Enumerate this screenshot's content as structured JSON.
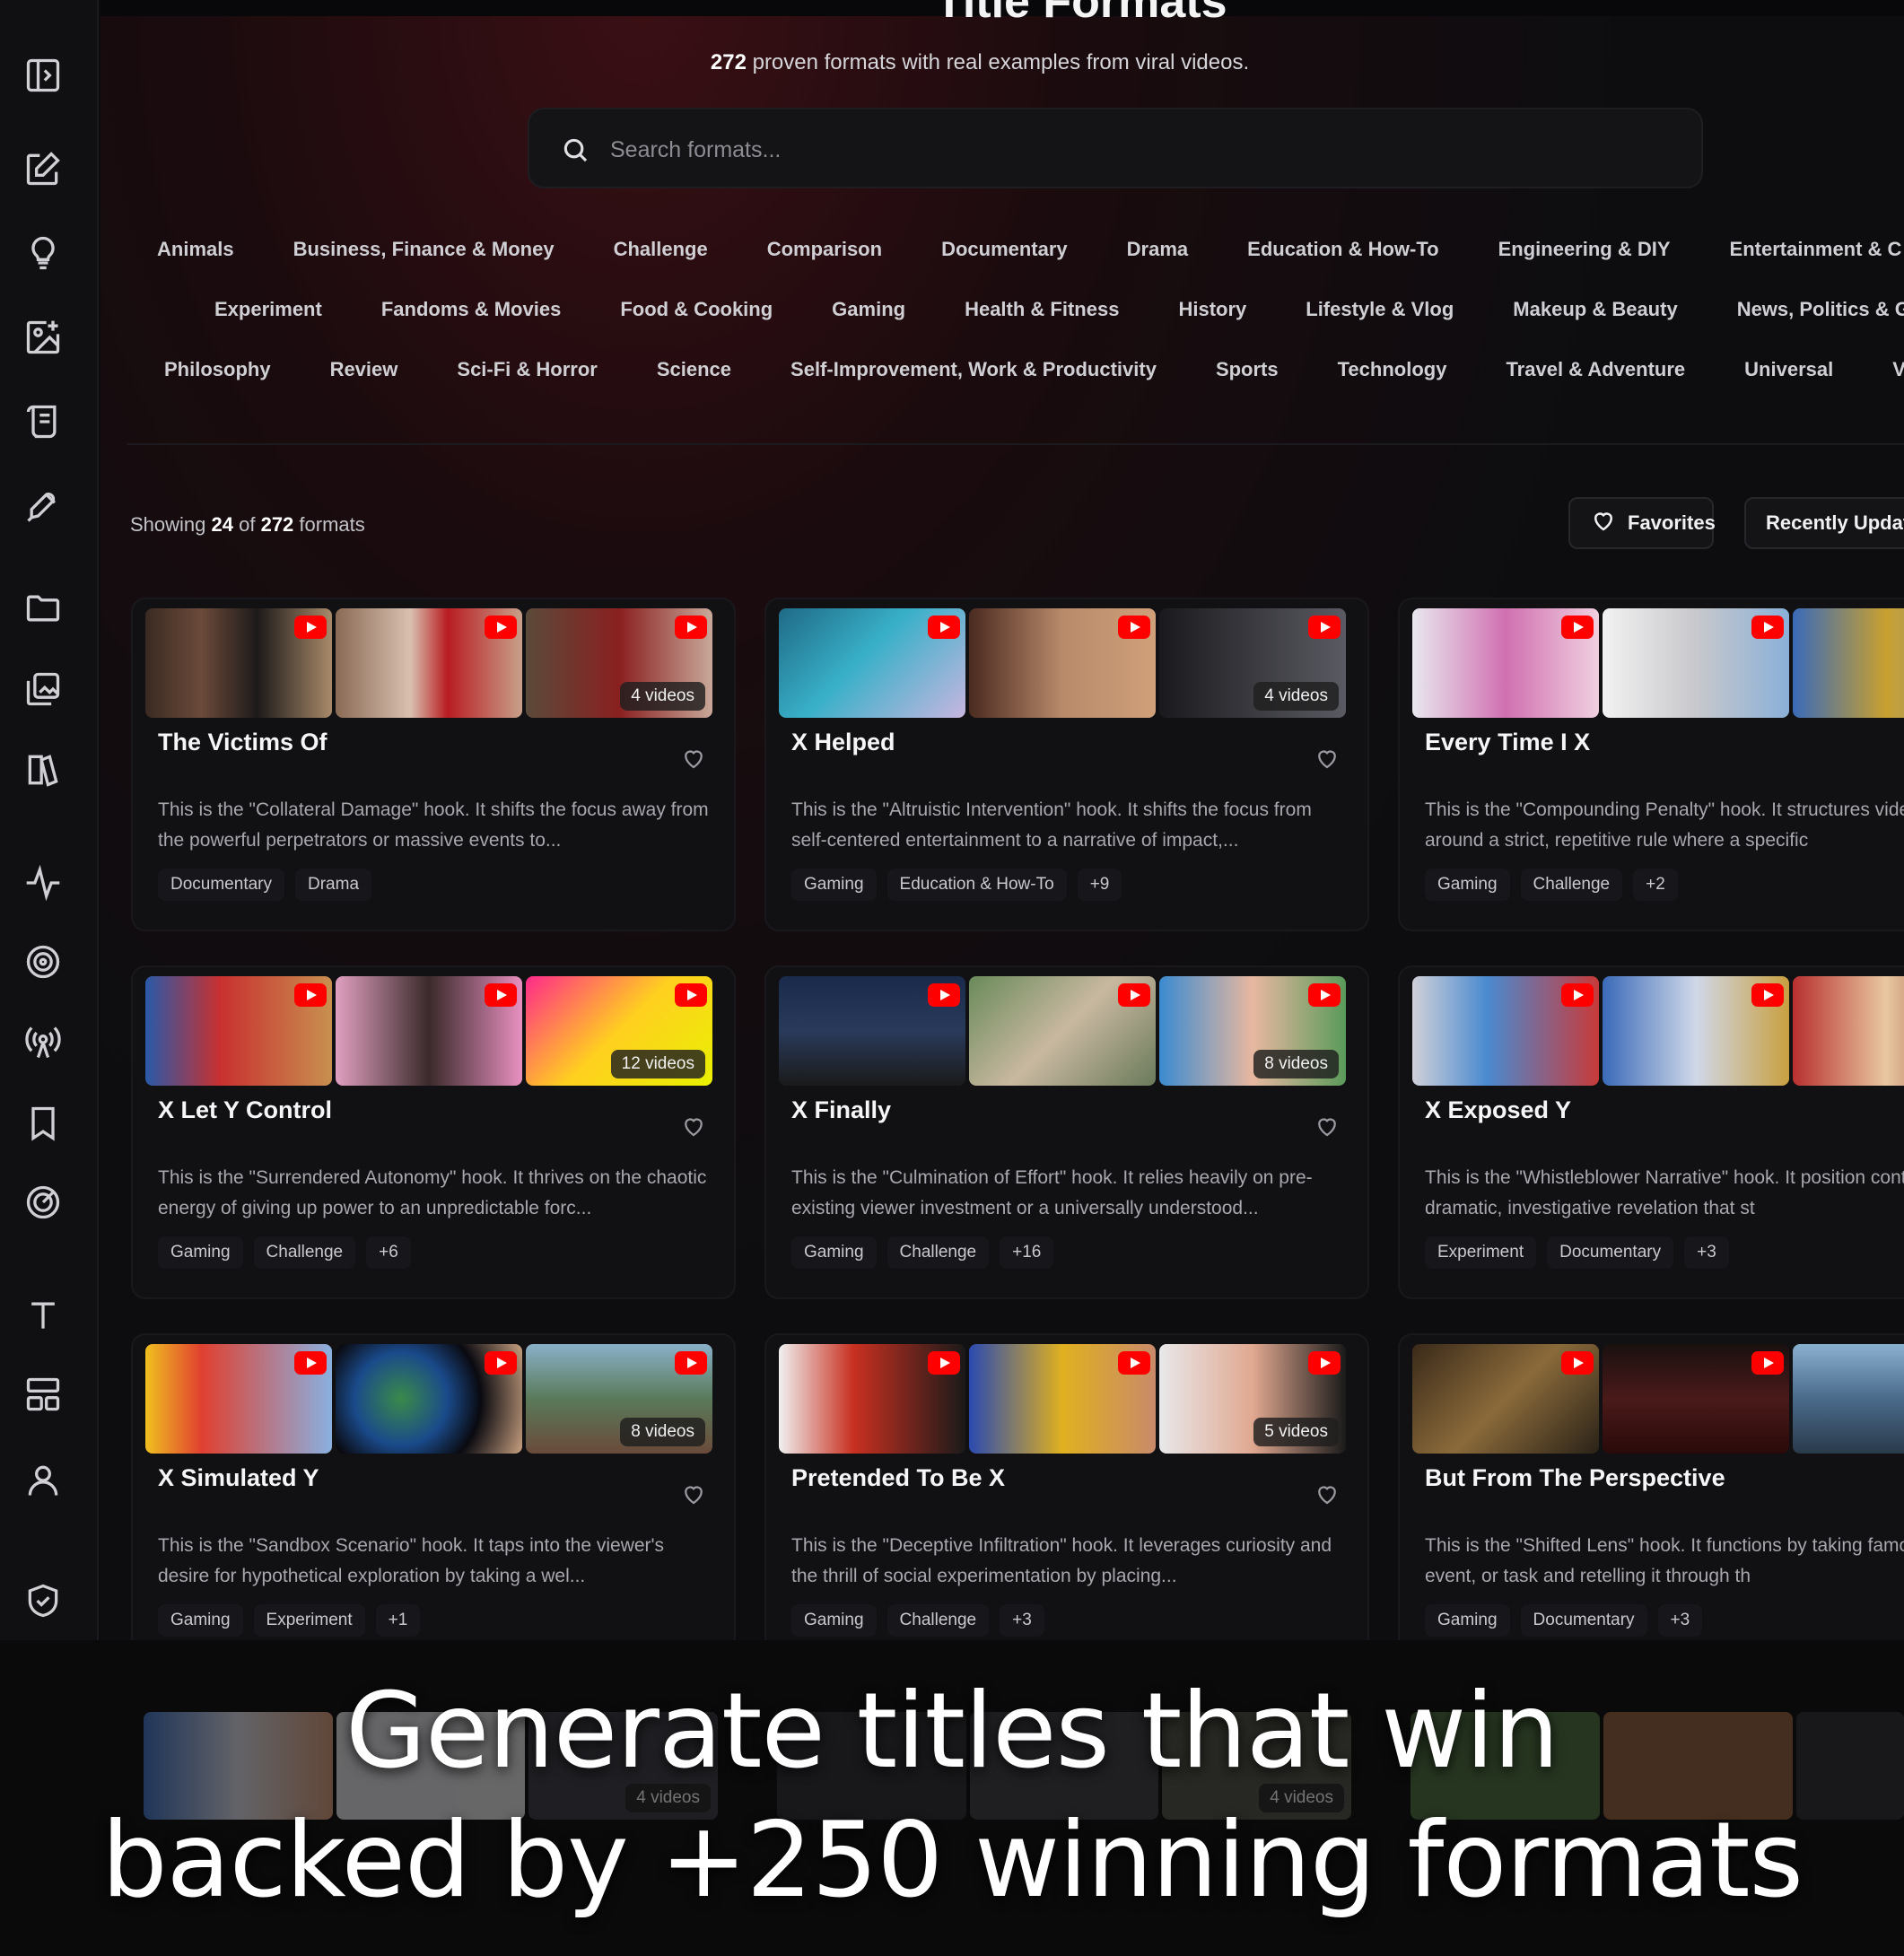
{
  "header": {
    "title_partial": "Title Formats",
    "subtitle_count": "272",
    "subtitle_rest": " proven formats with real examples from viral videos."
  },
  "search": {
    "placeholder": "Search formats..."
  },
  "categories": {
    "row1": [
      "Animals",
      "Business, Finance & Money",
      "Challenge",
      "Comparison",
      "Documentary",
      "Drama",
      "Education & How-To",
      "Engineering & DIY",
      "Entertainment & C"
    ],
    "row2": [
      "Experiment",
      "Fandoms & Movies",
      "Food & Cooking",
      "Gaming",
      "Health & Fitness",
      "History",
      "Lifestyle & Vlog",
      "Makeup & Beauty",
      "News, Politics & Geo"
    ],
    "row3": [
      "Philosophy",
      "Review",
      "Sci-Fi & Horror",
      "Science",
      "Self-Improvement, Work & Productivity",
      "Sports",
      "Technology",
      "Travel & Adventure",
      "Universal",
      "Ve"
    ]
  },
  "results": {
    "prefix": "Showing ",
    "shown": "24",
    "of": " of ",
    "total": "272",
    "suffix": " formats"
  },
  "toolbar": {
    "favorites_label": "Favorites",
    "sort_label": "Recently Updat"
  },
  "cards": [
    {
      "title": "The Victims Of",
      "videos": "4 videos",
      "desc": "This is the \"Collateral Damage\" hook. It shifts the focus away from the powerful perpetrators or massive events to...",
      "tags": [
        "Documentary",
        "Drama"
      ],
      "extra": ""
    },
    {
      "title": "X Helped",
      "videos": "4 videos",
      "desc": "This is the \"Altruistic Intervention\" hook. It shifts the focus from self-centered entertainment to a narrative of impact,...",
      "tags": [
        "Gaming",
        "Education & How-To"
      ],
      "extra": "+9"
    },
    {
      "title": "Every Time I X",
      "videos": "",
      "desc": "This is the \"Compounding Penalty\" hook. It structures video around a strict, repetitive rule where a specific",
      "tags": [
        "Gaming",
        "Challenge"
      ],
      "extra": "+2"
    },
    {
      "title": "X Let Y Control",
      "videos": "12 videos",
      "desc": "This is the \"Surrendered Autonomy\" hook. It thrives on the chaotic energy of giving up power to an unpredictable forc...",
      "tags": [
        "Gaming",
        "Challenge"
      ],
      "extra": "+6"
    },
    {
      "title": "X Finally",
      "videos": "8 videos",
      "desc": "This is the \"Culmination of Effort\" hook. It relies heavily on pre-existing viewer investment or a universally understood...",
      "tags": [
        "Gaming",
        "Challenge"
      ],
      "extra": "+16"
    },
    {
      "title": "X Exposed Y",
      "videos": "",
      "desc": "This is the \"Whistleblower Narrative\" hook. It position content as a dramatic, investigative revelation that st",
      "tags": [
        "Experiment",
        "Documentary"
      ],
      "extra": "+3"
    },
    {
      "title": "X Simulated Y",
      "videos": "8 videos",
      "desc": "This is the \"Sandbox Scenario\" hook. It taps into the viewer's desire for hypothetical exploration by taking a wel...",
      "tags": [
        "Gaming",
        "Experiment"
      ],
      "extra": "+1"
    },
    {
      "title": "Pretended To Be X",
      "videos": "5 videos",
      "desc": "This is the \"Deceptive Infiltration\" hook. It leverages curiosity and the thrill of social experimentation by placing...",
      "tags": [
        "Gaming",
        "Challenge"
      ],
      "extra": "+3"
    },
    {
      "title": "But From The Perspective",
      "videos": "",
      "desc": "This is the \"Shifted Lens\" hook. It functions by taking famous story, event, or task and retelling it through th",
      "tags": [
        "Gaming",
        "Documentary"
      ],
      "extra": "+3"
    }
  ],
  "ghost_counts": [
    "4 videos",
    "4 videos"
  ],
  "caption": {
    "line1": "Generate titles that win",
    "line2": "backed by +250 winning formats"
  },
  "icons": {
    "sidebar": [
      "sidebar-toggle-icon",
      "edit-icon",
      "lightbulb-icon",
      "image-edit-icon",
      "script-icon",
      "rocket-icon",
      "folder-icon",
      "gallery-icon",
      "book-icon",
      "activity-icon",
      "target-icon",
      "broadcast-icon",
      "bookmark-icon",
      "radar-icon",
      "text-icon",
      "layout-icon",
      "user-icon",
      "shield-check-icon",
      "bot-icon",
      "send-icon"
    ]
  },
  "colors": {
    "accent": "#ff0000",
    "background": "#0b0b0d",
    "card": "#111114"
  }
}
